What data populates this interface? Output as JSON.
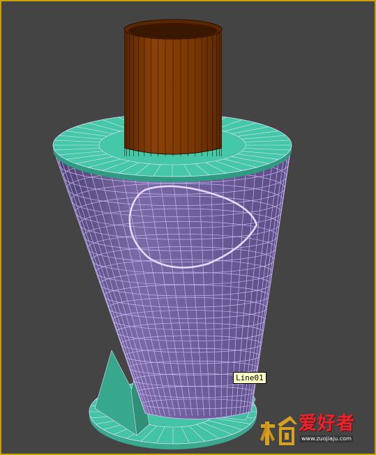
{
  "viewport": {
    "background_color": "#444444",
    "active_border_color": "#c8a000"
  },
  "scene_objects": [
    {
      "name": "pipe",
      "color": "#7a3500"
    },
    {
      "name": "top-disc",
      "color": "#3fbfa0"
    },
    {
      "name": "cone",
      "color": "#6a5a95"
    },
    {
      "name": "bottom-base",
      "color": "#3fbfa0"
    },
    {
      "name": "support-fins",
      "color": "#3fbfa0"
    }
  ],
  "wireframe_color": "#c8b4f0",
  "tooltip": {
    "label": "Line01"
  },
  "watermark": {
    "title": "爱好者",
    "url": "www.zuojiaju.com"
  }
}
